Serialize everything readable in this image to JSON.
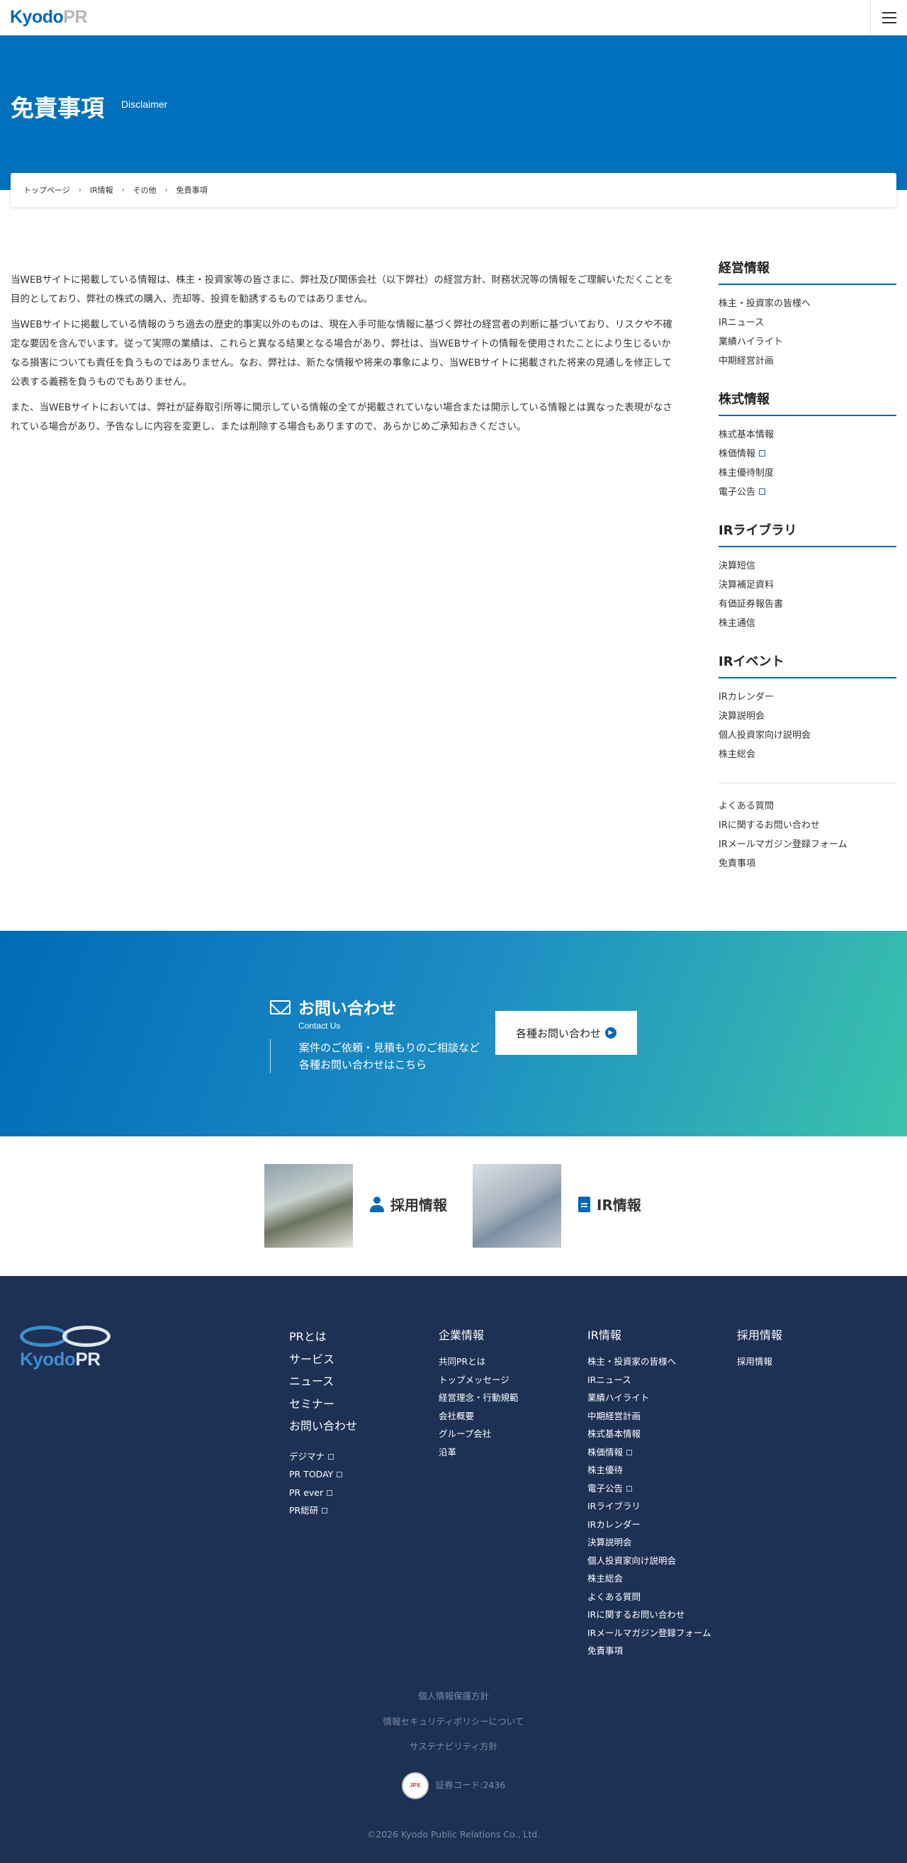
{
  "header": {
    "logo_kyodo": "Kyodo",
    "logo_pr": "PR"
  },
  "hero": {
    "title": "免責事項",
    "subtitle": "Disclaimer"
  },
  "breadcrumb": [
    "トップページ",
    "IR情報",
    "その他",
    "免責事項"
  ],
  "main": {
    "paragraphs": [
      "当WEBサイトに掲載している情報は、株主・投資家等の皆さまに、弊社及び関係会社（以下弊社）の経営方針、財務状況等の情報をご理解いただくことを目的としており、弊社の株式の購入、売却等、投資を勧誘するものではありません。",
      "当WEBサイトに掲載している情報のうち過去の歴史的事実以外のものは、現在入手可能な情報に基づく弊社の経営者の判断に基づいており、リスクや不確定な要因を含んでいます。従って実際の業績は、これらと異なる結果となる場合があり、弊社は、当WEBサイトの情報を使用されたことにより生じるいかなる損害についても責任を負うものではありません。なお、弊社は、新たな情報や将来の事象により、当WEBサイトに掲載された将来の見通しを修正して公表する義務を負うものでもありません。",
      "また、当WEBサイトにおいては、弊社が証券取引所等に開示している情報の全てが掲載されていない場合または開示している情報とは異なった表現がなされている場合があり、予告なしに内容を変更し、または削除する場合もありますので、あらかじめご承知おきください。"
    ]
  },
  "sidebar": {
    "sections": [
      {
        "title": "経営情報",
        "items": [
          "株主・投資家の皆様へ",
          "IRニュース",
          "業績ハイライト",
          "中期経営計画"
        ]
      },
      {
        "title": "株式情報",
        "items": [
          "株式基本情報",
          "株価情報",
          "株主優待制度",
          "電子公告"
        ]
      },
      {
        "title": "IRライブラリ",
        "items": [
          "決算短信",
          "決算補足資料",
          "有価証券報告書",
          "株主通信"
        ]
      },
      {
        "title": "IRイベント",
        "items": [
          "IRカレンダー",
          "決算説明会",
          "個人投資家向け説明会",
          "株主総会"
        ]
      }
    ],
    "extra": [
      "よくある質問",
      "IRに関するお問い合わせ",
      "IRメールマガジン登録フォーム",
      "免責事項"
    ]
  },
  "contact": {
    "title": "お問い合わせ",
    "subtitle": "Contact Us",
    "desc_line1": "案件のご依頼・見積もりのご相談など",
    "desc_line2": "各種お問い合わせはこちら",
    "button_label": "各種お問い合わせ"
  },
  "links": {
    "recruit_label": "採用情報",
    "ir_label": "IR情報"
  },
  "footer": {
    "logo_kyodo": "Kyodo",
    "logo_pr": "PR",
    "col1_main": [
      "PRとは",
      "サービス",
      "ニュース",
      "セミナー",
      "お問い合わせ"
    ],
    "col1_sub": [
      "デジマナ",
      "PR TODAY",
      "PR ever",
      "PR総研"
    ],
    "col2_title": "企業情報",
    "col2_items": [
      "共同PRとは",
      "トップメッセージ",
      "経営理念・行動規範",
      "会社概要",
      "グループ会社",
      "沿革"
    ],
    "col3_title": "IR情報",
    "col3_items": [
      "株主・投資家の皆様へ",
      "IRニュース",
      "業績ハイライト",
      "中期経営計画",
      "株式基本情報",
      "株価情報",
      "株主優待",
      "電子公告",
      "IRライブラリ",
      "IRカレンダー",
      "決算説明会",
      "個人投資家向け説明会",
      "株主総会",
      "よくある質問",
      "IRに関するお問い合わせ",
      "IRメールマガジン登録フォーム",
      "免責事項"
    ],
    "col4_title": "採用情報",
    "col4_items": [
      "採用情報"
    ],
    "privacy": "個人情報保護方針",
    "security": "情報セキュリティポリシーについて",
    "sustainability": "サステナビリティ方針",
    "stock_code": "証券コード:2436",
    "copyright": "©2026 Kyodo Public Relations Co., Ltd."
  }
}
